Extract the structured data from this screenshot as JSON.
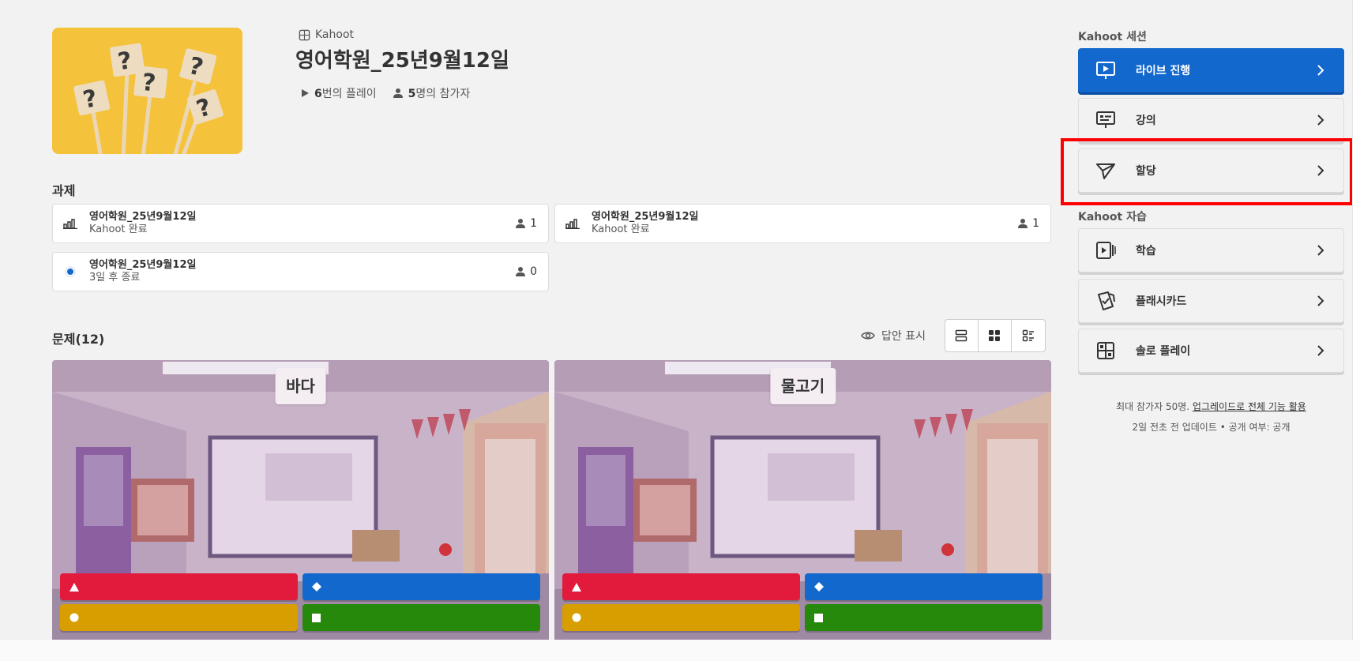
{
  "header": {
    "kahoot_tag": "Kahoot",
    "title": "영어학원_25년9월12일",
    "plays_count": "6",
    "plays_suffix": "번의 플레이",
    "participants_count": "5",
    "participants_suffix": "명의 참가자"
  },
  "assignments": {
    "section_title": "과제",
    "items": [
      {
        "name": "영어학원_25년9월12일",
        "status": "Kahoot 완료",
        "count": "1",
        "icon": "bar-chart-icon"
      },
      {
        "name": "영어학원_25년9월12일",
        "status": "Kahoot 완료",
        "count": "1",
        "icon": "bar-chart-icon"
      },
      {
        "name": "영어학원_25년9월12일",
        "status": "3일 후 종료",
        "count": "0",
        "icon": "active-dot-icon"
      }
    ]
  },
  "questions": {
    "section_title": "문제(12)",
    "show_answers_label": "답안 표시",
    "view_modes": [
      "list-view-icon",
      "grid-view-icon",
      "detail-view-icon"
    ],
    "active_view": "grid-view-icon",
    "items": [
      {
        "title": "바다"
      },
      {
        "title": "물고기"
      }
    ],
    "answer_colors": {
      "red": "#e21b3c",
      "blue": "#1368ce",
      "yellow": "#d89e00",
      "green": "#26890c"
    }
  },
  "sidebar": {
    "session_title": "Kahoot 세션",
    "session_actions": [
      {
        "label": "라이브 진행",
        "icon": "present-screen-icon",
        "primary": true
      },
      {
        "label": "강의",
        "icon": "lecture-board-icon"
      },
      {
        "label": "할당",
        "icon": "send-paper-plane-icon"
      }
    ],
    "selfstudy_title": "Kahoot 자습",
    "selfstudy_actions": [
      {
        "label": "학습",
        "icon": "study-play-icon"
      },
      {
        "label": "플래시카드",
        "icon": "flashcard-icon"
      },
      {
        "label": "솔로 플레이",
        "icon": "solo-grid-icon"
      }
    ],
    "footer_prefix": "최대 참가자 50명.",
    "footer_link": "업그레이드로 전체 기능 활용",
    "footer_line2": "2일 전초 전 업데이트 • 공개 여부: 공개"
  },
  "colors": {
    "primary": "#1368ce",
    "highlight": "#ff0000"
  }
}
